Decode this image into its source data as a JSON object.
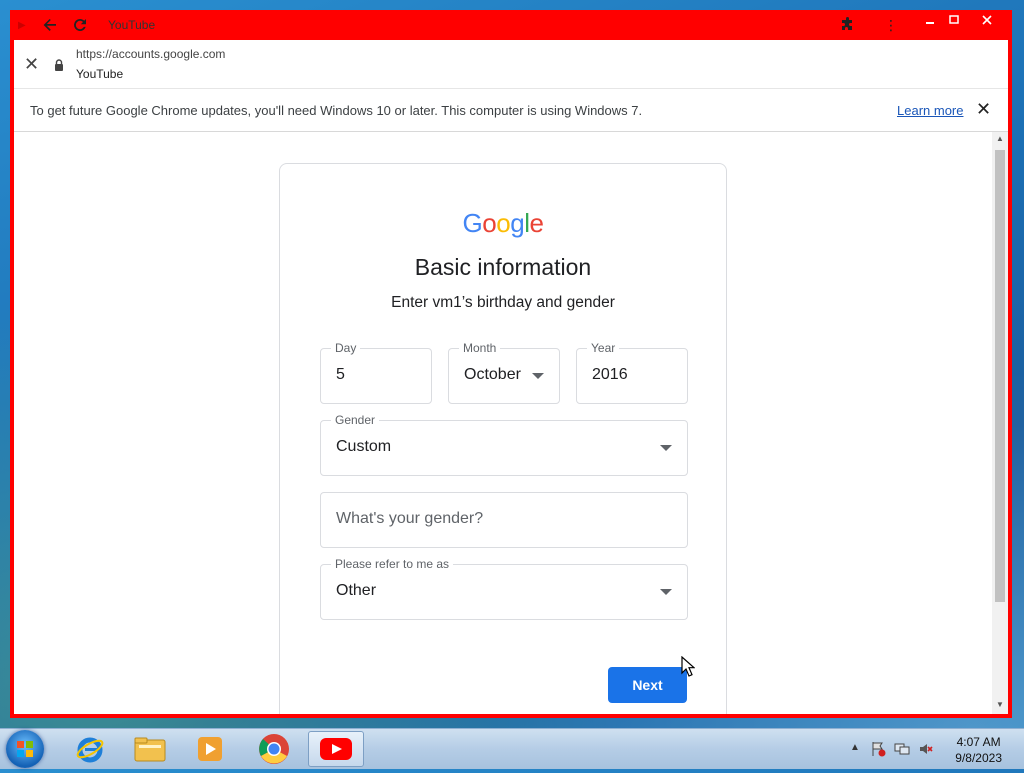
{
  "browser": {
    "tab_title": "YouTube",
    "url": "https://accounts.google.com",
    "site_name": "YouTube"
  },
  "infobar": {
    "message": "To get future Google Chrome updates, you'll need Windows 10 or later. This computer is using Windows 7.",
    "link": "Learn more"
  },
  "page": {
    "logo": [
      "G",
      "o",
      "o",
      "g",
      "l",
      "e"
    ],
    "logo_colors": [
      "#4285F4",
      "#EA4335",
      "#FBBC05",
      "#4285F4",
      "#34A853",
      "#EA4335"
    ],
    "title": "Basic information",
    "subtitle": "Enter vm1’s birthday and gender",
    "day": {
      "label": "Day",
      "value": "5"
    },
    "month": {
      "label": "Month",
      "value": "October"
    },
    "year": {
      "label": "Year",
      "value": "2016"
    },
    "gender": {
      "label": "Gender",
      "value": "Custom"
    },
    "custom_gender": {
      "placeholder": "What's your gender?"
    },
    "pronoun": {
      "label": "Please refer to me as",
      "value": "Other"
    },
    "next_button": "Next"
  },
  "taskbar": {
    "time": "4:07 AM",
    "date": "9/8/2023"
  },
  "colors": {
    "accent": "#1a73e8",
    "window_frame": "#ff0000"
  }
}
